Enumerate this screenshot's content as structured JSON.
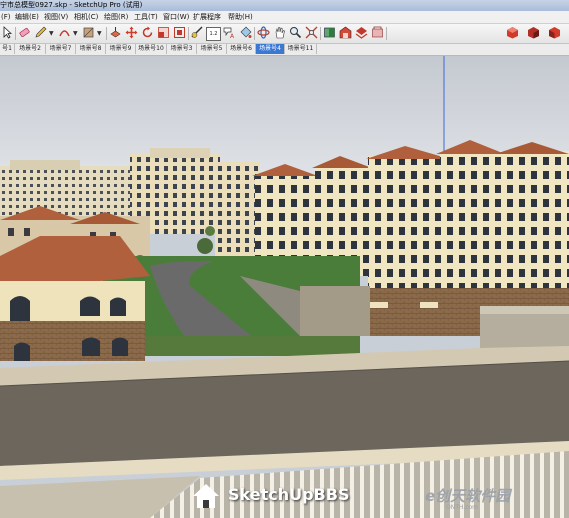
{
  "window": {
    "title": "宁市总模型0927.skp - SketchUp Pro (试用)"
  },
  "menu": {
    "items": [
      "(F)",
      "编辑(E)",
      "视图(V)",
      "相机(C)",
      "绘图(R)",
      "工具(T)",
      "窗口(W)",
      "扩展程序",
      "帮助(H)"
    ]
  },
  "toolbar": {
    "tools": [
      "select-tool",
      "eraser-tool",
      "pencil-tool",
      "arc-tool",
      "rectangle-tool",
      "push-pull-tool",
      "move-tool",
      "rotate-tool",
      "scale-tool",
      "offset-tool",
      "tape-measure-tool",
      "text-tool",
      "paint-bucket-tool",
      "orbit-tool",
      "pan-tool",
      "zoom-tool",
      "zoom-extents-tool",
      "component-tool",
      "warehouse-tool",
      "share-model-tool",
      "extension-tool",
      "ruby-tool"
    ],
    "dimension_label": "1.2"
  },
  "scenes": {
    "tabs": [
      "号1",
      "场景号2",
      "场景号7",
      "场景号8",
      "场景号9",
      "场景号10",
      "场景号3",
      "场景号5",
      "场景号6",
      "场景号4",
      "场景号11"
    ],
    "active_index": 9
  },
  "watermark": {
    "logo_text": "SketchUpBBS",
    "cn_text": "e创天软件园",
    "cn_sub": "ONTH.com"
  },
  "colors": {
    "active_tab": "#3a78d6",
    "sky": "#d9dde3",
    "roof": "#b0603c",
    "building_cream": "#efe3bc",
    "grass": "#4a7d3a",
    "road": "#6a6a6a"
  }
}
